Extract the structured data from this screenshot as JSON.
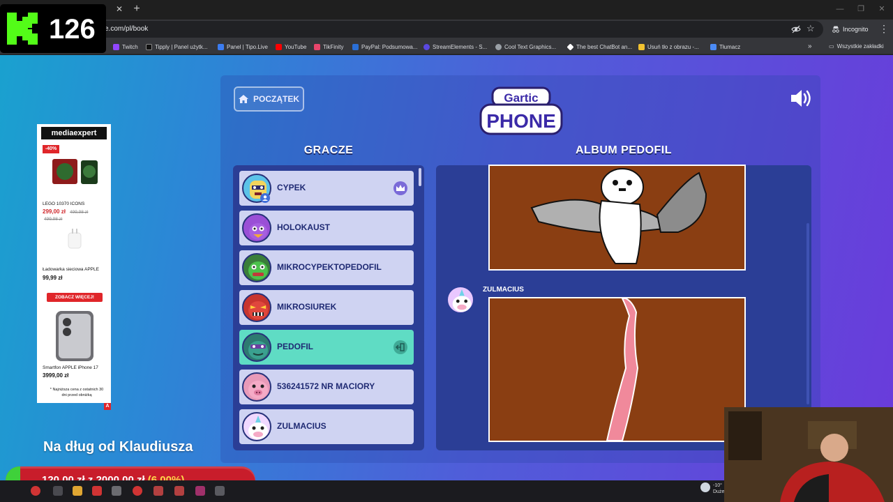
{
  "browser": {
    "url": "e.com/pl/book",
    "incognito_label": "Incognito",
    "bookmarks": [
      "Twitch",
      "Tipply | Panel użytk...",
      "Panel | Tipo.Live",
      "YouTube",
      "TikFinity",
      "PayPal: Podsumowa...",
      "StreamElements - S...",
      "Cool Text Graphics...",
      "The best ChatBot an...",
      "Usuń tło z obrazu -...",
      "Tłumacz"
    ],
    "all_bookmarks_label": "Wszystkie zakładki"
  },
  "game": {
    "home_button_label": "POCZĄTEK",
    "logo_top": "Gartic",
    "logo_bottom": "PHONE",
    "players_title": "GRACZE",
    "album_title": "ALBUM PEDOFIL",
    "players": [
      {
        "name": "CYPEK",
        "badge": "crown-icon",
        "active": false
      },
      {
        "name": "HOLOKAUST",
        "badge": "",
        "active": false
      },
      {
        "name": "MIKROCYPEKTOPEDOFIL",
        "badge": "",
        "active": false
      },
      {
        "name": "MIKROSIUREK",
        "badge": "",
        "active": false
      },
      {
        "name": "PEDOFIL",
        "badge": "exit-icon",
        "active": true
      },
      {
        "name": "536241572 NR MACIORY",
        "badge": "",
        "active": false
      },
      {
        "name": "ZULMACIUS",
        "badge": "",
        "active": false
      }
    ],
    "album_author": "ZULMACIUS"
  },
  "ad": {
    "brand": "mediaexpert",
    "discount": "-40%",
    "product1_name": "LEGO 10370 ICONS",
    "product1_price": "299,00 zł",
    "product1_old_price": "499,98 zł",
    "product1_old_price2": "499,98 zł",
    "product2_name": "Ładowarka sieciowa APPLE",
    "product2_price": "99,99 zł",
    "cta": "ZOBACZ WIĘCEJ!",
    "product3_name": "Smartfon APPLE iPhone 17",
    "product3_price": "3999,00 zł",
    "footnote_1": "* Najniższa cena z ostatnich 30",
    "footnote_2": "dni przed obniżką"
  },
  "overlay": {
    "viewer_count": "126",
    "goal_title": "Na dług od Klaudiusza",
    "goal_current": "120,00 zł",
    "goal_joiner": "z",
    "goal_target": "2000,00 zł",
    "goal_percent_text": "(6.00%)",
    "goal_fraction": 0.06
  },
  "taskbar": {
    "weather_temp": "-10°",
    "weather_desc": "Duże"
  },
  "colors": {
    "player_bg": "#cfd3f2",
    "player_active_bg": "#5fdcc4",
    "panel_bg": "#2b3e96",
    "canvas_bg": "#8a3e12",
    "goal_fill": "#3fd13a",
    "goal_bg": "#c81d2b"
  }
}
